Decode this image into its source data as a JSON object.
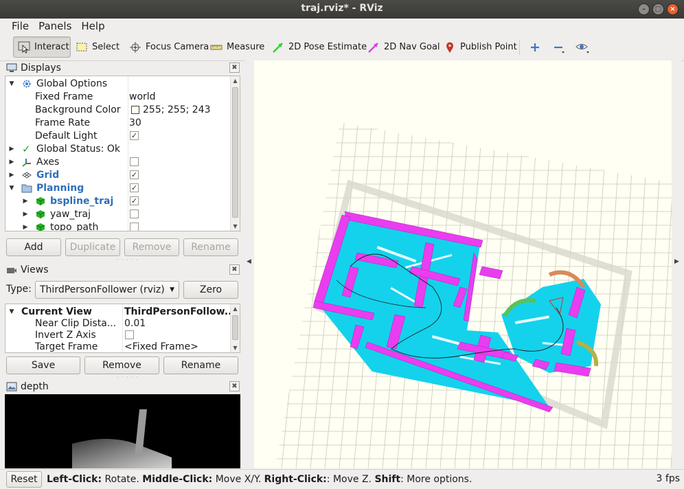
{
  "window": {
    "title": "traj.rviz* - RViz"
  },
  "menu": [
    "File",
    "Panels",
    "Help"
  ],
  "toolbar": {
    "interact": "Interact",
    "select": "Select",
    "focus_camera": "Focus Camera",
    "measure": "Measure",
    "pose_estimate": "2D Pose Estimate",
    "nav_goal": "2D Nav Goal",
    "publish_point": "Publish Point"
  },
  "displays": {
    "title": "Displays",
    "rows": [
      {
        "label": "Global Options",
        "value": ""
      },
      {
        "label": "Fixed Frame",
        "value": "world"
      },
      {
        "label": "Background Color",
        "value": "255; 255; 243"
      },
      {
        "label": "Frame Rate",
        "value": "30"
      },
      {
        "label": "Default Light",
        "value": "✓"
      },
      {
        "label": "Global Status: Ok",
        "value": ""
      },
      {
        "label": "Axes",
        "value": ""
      },
      {
        "label": "Grid",
        "value": "✓"
      },
      {
        "label": "Planning",
        "value": "✓"
      },
      {
        "label": "bspline_traj",
        "value": "✓"
      },
      {
        "label": "yaw_traj",
        "value": ""
      },
      {
        "label": "topo_path",
        "value": ""
      }
    ],
    "buttons": {
      "add": "Add",
      "duplicate": "Duplicate",
      "remove": "Remove",
      "rename": "Rename"
    }
  },
  "views": {
    "title": "Views",
    "type_label": "Type:",
    "type_value": "ThirdPersonFollower (rviz)",
    "zero": "Zero",
    "rows": [
      {
        "label": "Current View",
        "value": "ThirdPersonFollow..."
      },
      {
        "label": "Near Clip Dista...",
        "value": "0.01"
      },
      {
        "label": "Invert Z Axis",
        "value": ""
      },
      {
        "label": "Target Frame",
        "value": "<Fixed Frame>"
      }
    ],
    "buttons": {
      "save": "Save",
      "remove": "Remove",
      "rename": "Rename"
    }
  },
  "depth": {
    "title": "depth"
  },
  "status": {
    "reset": "Reset",
    "hint_parts": [
      {
        "b": "Left-Click:",
        "t": " Rotate. "
      },
      {
        "b": "Middle-Click:",
        "t": " Move X/Y. "
      },
      {
        "b": "Right-Click:",
        "t": ": Move Z. "
      },
      {
        "b": "Shift",
        "t": ": More options."
      }
    ],
    "fps": "3 fps"
  },
  "colors": {
    "background": "#fffff3",
    "map_floor": "#14d2ec",
    "map_walls": "#e93df0",
    "panel_bg": "#efeeec",
    "accent_blue": "#2e6fba"
  }
}
